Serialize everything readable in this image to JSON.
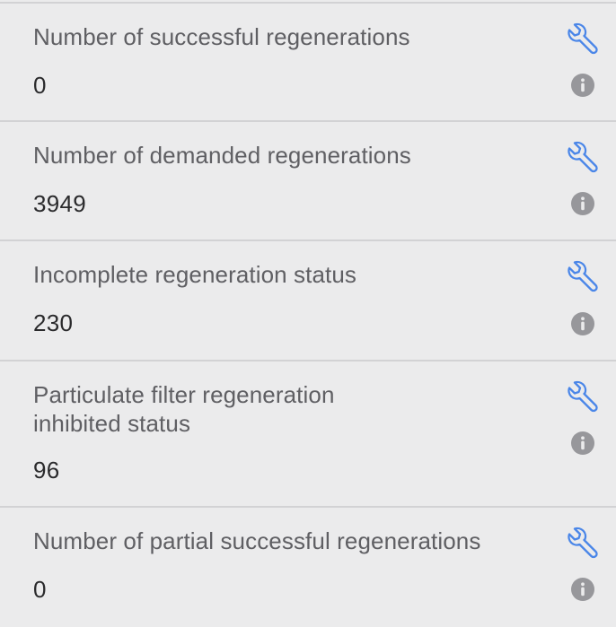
{
  "rows": [
    {
      "label": "Number of successful regenerations",
      "value": "0",
      "icon": "wrench-icon",
      "info_icon": "info-icon"
    },
    {
      "label": "Number of demanded regenerations",
      "value": "3949",
      "icon": "wrench-icon",
      "info_icon": "info-icon"
    },
    {
      "label": "Incomplete regeneration status",
      "value": "230",
      "icon": "wrench-icon",
      "info_icon": "info-icon"
    },
    {
      "label": "Particulate filter regeneration inhibited status",
      "value": "96",
      "icon": "wrench-icon",
      "info_icon": "info-icon"
    },
    {
      "label": "Number of partial successful regenerations",
      "value": "0",
      "icon": "wrench-icon",
      "info_icon": "info-icon"
    }
  ],
  "colors": {
    "background": "#ebebec",
    "divider": "#d2d2d4",
    "label": "#5f5f63",
    "value": "#2a2a2c",
    "accent": "#4a86e8",
    "info": "#97979b"
  }
}
